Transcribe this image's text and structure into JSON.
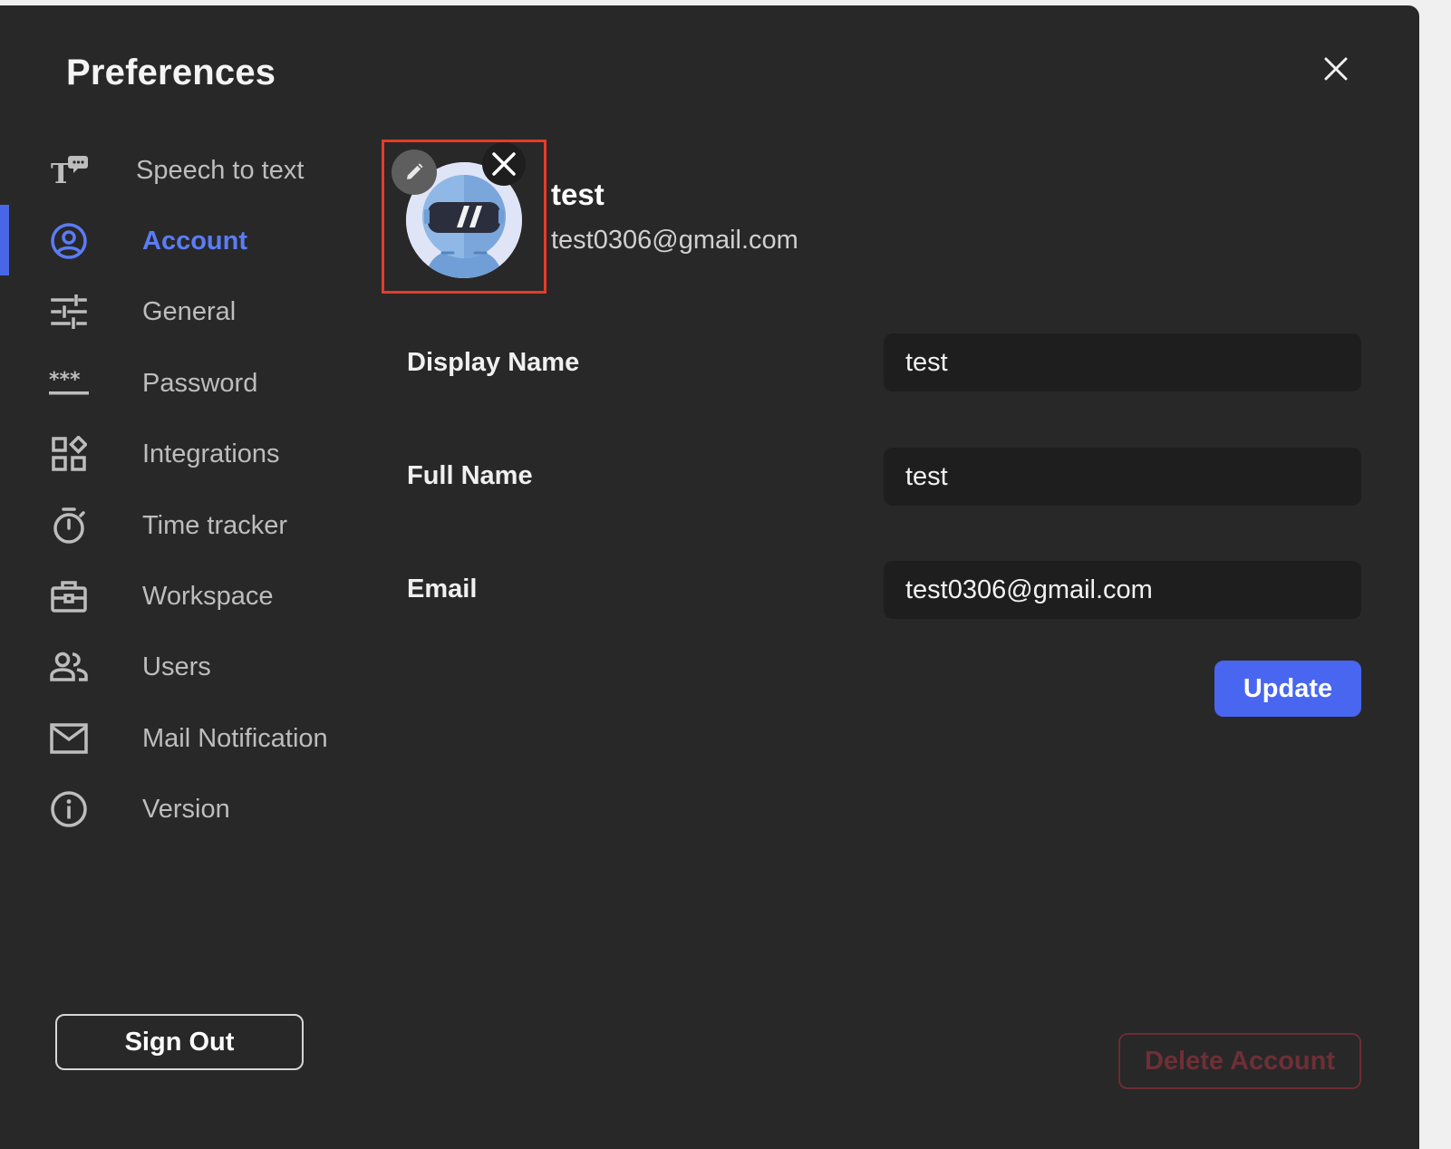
{
  "header": {
    "title": "Preferences"
  },
  "sidebar": {
    "items": [
      {
        "label": "Speech to text",
        "icon": "speech-to-text-icon",
        "active": false
      },
      {
        "label": "Account",
        "icon": "account-circle-icon",
        "active": true
      },
      {
        "label": "General",
        "icon": "sliders-icon",
        "active": false
      },
      {
        "label": "Password",
        "icon": "password-asterisks-icon",
        "active": false
      },
      {
        "label": "Integrations",
        "icon": "integrations-grid-icon",
        "active": false
      },
      {
        "label": "Time tracker",
        "icon": "stopwatch-icon",
        "active": false
      },
      {
        "label": "Workspace",
        "icon": "briefcase-icon",
        "active": false
      },
      {
        "label": "Users",
        "icon": "users-icon",
        "active": false
      },
      {
        "label": "Mail Notification",
        "icon": "envelope-icon",
        "active": false
      },
      {
        "label": "Version",
        "icon": "info-icon",
        "active": false
      }
    ],
    "sign_out_label": "Sign Out"
  },
  "profile": {
    "name": "test",
    "email": "test0306@gmail.com",
    "avatar_icon": "astronaut-avatar"
  },
  "form": {
    "display_name": {
      "label": "Display Name",
      "value": "test"
    },
    "full_name": {
      "label": "Full Name",
      "value": "test"
    },
    "email": {
      "label": "Email",
      "value": "test0306@gmail.com"
    },
    "update_label": "Update"
  },
  "danger": {
    "delete_label": "Delete Account"
  },
  "colors": {
    "background": "#282828",
    "accent": "#4866f0",
    "active_nav": "#5b7cf5",
    "input_bg": "#1e1e1e",
    "danger": "#6e2f36",
    "highlight_border": "#e43c2a"
  }
}
